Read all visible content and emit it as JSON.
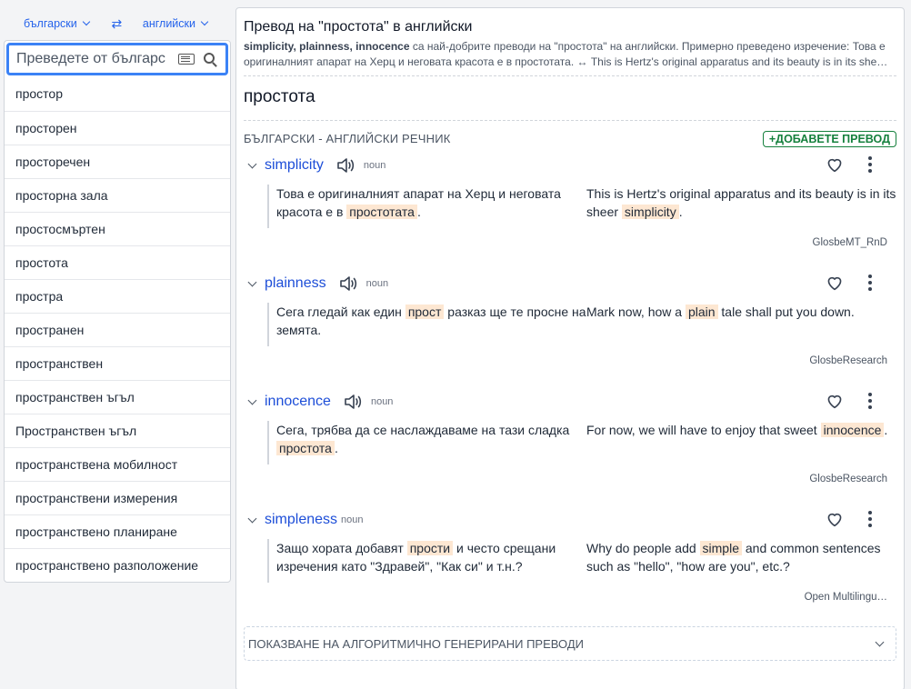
{
  "lang_bar": {
    "from": "български",
    "to": "английски",
    "swap": "⇄"
  },
  "search": {
    "placeholder": "Преведете от българс"
  },
  "word_list": [
    "простор",
    "просторен",
    "просторечен",
    "просторна зала",
    "простосмъртен",
    "простота",
    "простра",
    "пространен",
    "пространствен",
    "пространствен ъгъл",
    "Пространствен ъгъл",
    "пространствена мобилност",
    "пространствени измерения",
    "пространствено планиране",
    "пространствено разположение"
  ],
  "main": {
    "title": "Превод на \"простота\" в английски",
    "summary_bold": "simplicity, plainness, innocence",
    "summary_rest": " са най-добрите преводи на \"простота\" на английски. Примерно преведено изречение: Това е оригиналният апарат на Херц и неговата красота е в простотата. ↔ This is Hertz's original apparatus and its beauty is in its she…",
    "headword": "простота",
    "dict_label": "БЪЛГАРСКИ - АНГЛИЙСКИ РЕЧНИК",
    "add_button": "+ДОБАВЕТЕ ПРЕВОД",
    "algo_label": "ПОКАЗВАНЕ НА АЛГОРИТМИЧНО ГЕНЕРИРАНИ ПРЕВОДИ"
  },
  "entries": [
    {
      "term": "simplicity",
      "pos": "noun",
      "speaker": true,
      "src_pre": "Това е оригиналният апарат на Херц и неговата красота е в ",
      "src_hl": "простотата",
      "src_post": ".",
      "tgt_pre": "This is Hertz's original apparatus and its beauty is in its sheer ",
      "tgt_hl": "simplicity",
      "tgt_post": ".",
      "source": "GlosbeMT_RnD"
    },
    {
      "term": "plainness",
      "pos": "noun",
      "speaker": true,
      "src_pre": "Сега гледай как един ",
      "src_hl": "прост",
      "src_post": " разказ ще те просне на земята.",
      "tgt_pre": "Mark now, how a ",
      "tgt_hl": "plain",
      "tgt_post": " tale shall put you down.",
      "source": "GlosbeResearch"
    },
    {
      "term": "innocence",
      "pos": "noun",
      "speaker": true,
      "src_pre": "Сега, трябва да се наслаждаваме на тази сладка ",
      "src_hl": "простота",
      "src_post": ".",
      "tgt_pre": "For now, we will have to enjoy that sweet ",
      "tgt_hl": "innocence",
      "tgt_post": ".",
      "source": "GlosbeResearch"
    },
    {
      "term": "simpleness",
      "pos": "noun",
      "speaker": false,
      "src_pre": "Защо хората добавят ",
      "src_hl": "прости",
      "src_post": " и често срещани изречения като \"Здравей\", \"Как си\" и т.н.?",
      "tgt_pre": "Why do people add ",
      "tgt_hl": "simple",
      "tgt_post": " and common sentences such as \"hello\", \"how are you\", etc.?",
      "source": "Open Multilingu…"
    }
  ],
  "colors": {
    "accent": "#2563eb",
    "add": "#15803d",
    "highlight": "#fde7d2"
  },
  "icons": [
    "chevron-down-icon",
    "swap-icon",
    "keyboard-icon",
    "search-icon",
    "speaker-icon",
    "heart-icon",
    "more-vert-icon"
  ]
}
